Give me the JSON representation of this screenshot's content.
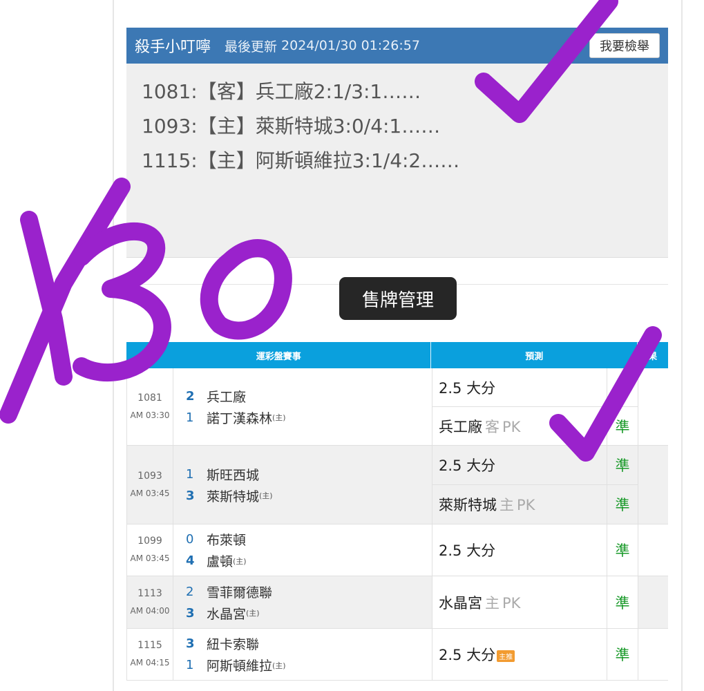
{
  "post": {
    "author": "殺手小叮嚀",
    "updated_label": "最後更新",
    "updated_time": "2024/01/30 01:26:57",
    "report_button": "我要檢舉",
    "lines": [
      "1081:【客】兵工廠2:1/3:1……",
      "1093:【主】萊斯特城3:0/4:1……",
      "1115:【主】阿斯頓維拉3:1/4:2……"
    ]
  },
  "sold_button": "售牌管理",
  "table": {
    "headers": {
      "match": "運彩盤賽事",
      "prediction": "預測",
      "result": "結果"
    },
    "home_mark": "(主)",
    "rows": [
      {
        "id": "1081",
        "time": "AM 03:30",
        "team1": {
          "score": "2",
          "name": "兵工廠"
        },
        "team2": {
          "score": "1",
          "name": "諾丁漢森林"
        },
        "preds": [
          {
            "pick": "2.5 大分",
            "side": "",
            "pk": "",
            "badge": "",
            "result": "準"
          },
          {
            "pick": "兵工廠",
            "side": "客",
            "pk": "PK",
            "badge": "",
            "result": "準"
          }
        ]
      },
      {
        "id": "1093",
        "time": "AM 03:45",
        "team1": {
          "score": "1",
          "name": "斯旺西城"
        },
        "team2": {
          "score": "3",
          "name": "萊斯特城"
        },
        "preds": [
          {
            "pick": "2.5 大分",
            "side": "",
            "pk": "",
            "badge": "",
            "result": "準"
          },
          {
            "pick": "萊斯特城",
            "side": "主",
            "pk": "PK",
            "badge": "",
            "result": "準"
          }
        ]
      },
      {
        "id": "1099",
        "time": "AM 03:45",
        "team1": {
          "score": "0",
          "name": "布萊頓"
        },
        "team2": {
          "score": "4",
          "name": "盧頓"
        },
        "preds": [
          {
            "pick": "2.5 大分",
            "side": "",
            "pk": "",
            "badge": "",
            "result": "準"
          }
        ]
      },
      {
        "id": "1113",
        "time": "AM 04:00",
        "team1": {
          "score": "2",
          "name": "雪菲爾德聯"
        },
        "team2": {
          "score": "3",
          "name": "水晶宮"
        },
        "preds": [
          {
            "pick": "水晶宮",
            "side": "主",
            "pk": "PK",
            "badge": "",
            "result": "準"
          }
        ]
      },
      {
        "id": "1115",
        "time": "AM 04:15",
        "team1": {
          "score": "3",
          "name": "紐卡索聯"
        },
        "team2": {
          "score": "1",
          "name": "阿斯頓維拉"
        },
        "preds": [
          {
            "pick": "2.5 大分",
            "side": "",
            "pk": "",
            "badge": "主推",
            "result": "準"
          }
        ]
      }
    ]
  },
  "handwriting": {
    "text": "1/30",
    "color": "#9a22cc"
  },
  "colors": {
    "header_bar": "#3c78b4",
    "table_header": "#0aa0dd",
    "score": "#1f6fb2",
    "result": "#1a9a2a",
    "badge": "#f29b30"
  }
}
